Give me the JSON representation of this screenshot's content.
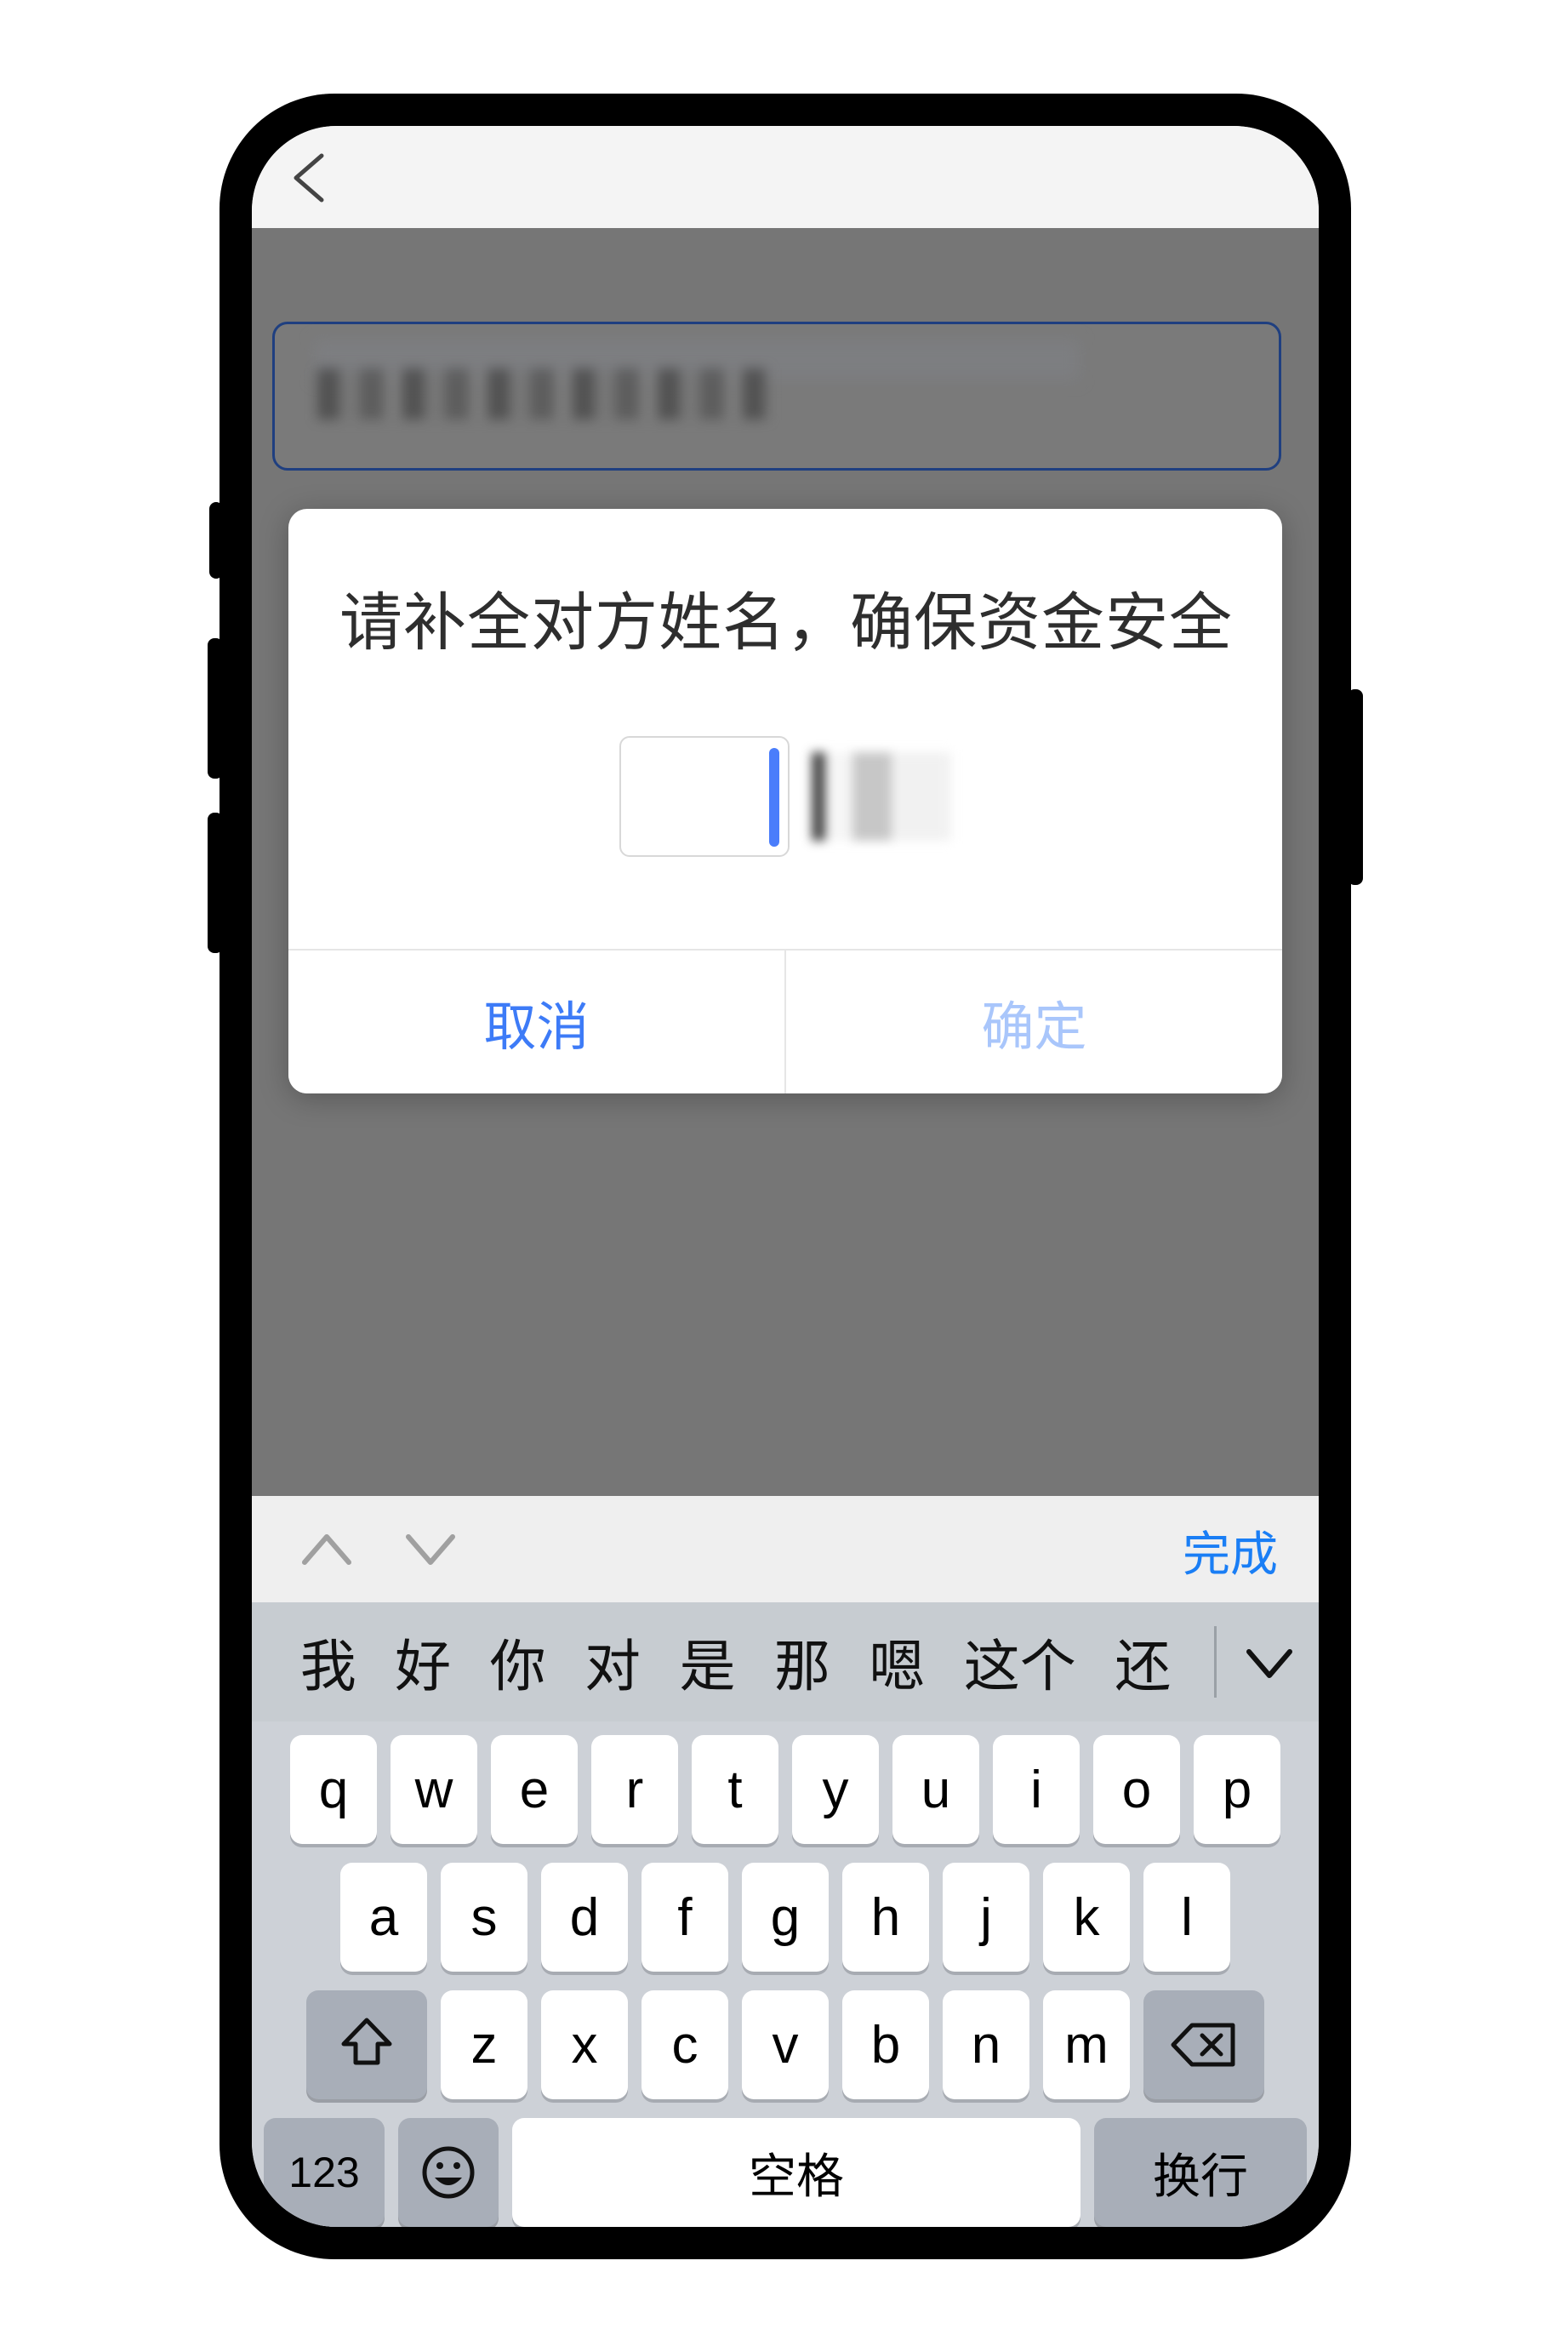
{
  "nav": {
    "back_icon": "chevron-left-icon"
  },
  "app_background": {
    "recipient_field_label": "",
    "recipient_field_value": "",
    "primary_action_label": ""
  },
  "dialog": {
    "title": "请补全对方姓名，确保资金安全",
    "input_value": "",
    "input_masked_name": "",
    "cancel_label": "取消",
    "confirm_label": "确定"
  },
  "keyboard_toolbar": {
    "prev_icon": "chevron-up-icon",
    "next_icon": "chevron-down-icon",
    "done_label": "完成"
  },
  "candidates": {
    "items": [
      "我",
      "好",
      "你",
      "对",
      "是",
      "那",
      "嗯",
      "这个",
      "还"
    ],
    "expand_icon": "chevron-down-icon"
  },
  "keyboard": {
    "row1": [
      "q",
      "w",
      "e",
      "r",
      "t",
      "y",
      "u",
      "i",
      "o",
      "p"
    ],
    "row2": [
      "a",
      "s",
      "d",
      "f",
      "g",
      "h",
      "j",
      "k",
      "l"
    ],
    "row3": [
      "z",
      "x",
      "c",
      "v",
      "b",
      "n",
      "m"
    ],
    "shift_icon": "shift-arrow-icon",
    "backspace_icon": "backspace-icon",
    "numbers_label": "123",
    "emoji_icon": "smiley-face-icon",
    "space_label": "空格",
    "return_label": "换行",
    "globe_icon": "globe-icon",
    "mic_icon": "microphone-icon"
  },
  "colors": {
    "accent_blue": "#1a7ef5",
    "cancel_blue": "#3d7bf7",
    "confirm_blue_disabled": "#a9c6fb",
    "primary_button_navy": "#1e3a73",
    "caret_blue": "#4a7dfb",
    "keyboard_bg": "#cdd1d7",
    "candidate_bg": "#c7ccd1",
    "app_overlay_gray": "#767676"
  }
}
